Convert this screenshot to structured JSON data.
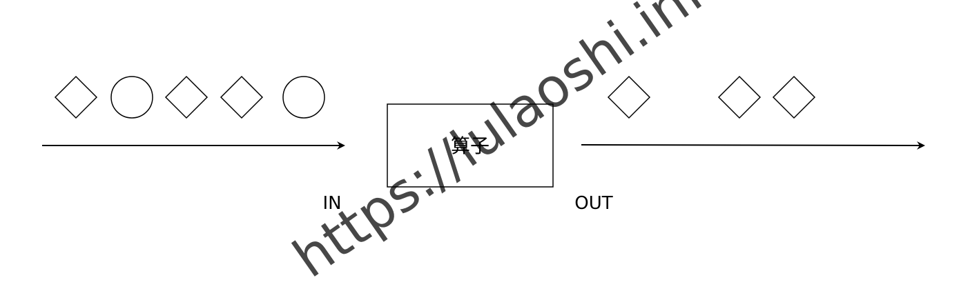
{
  "operator_box": {
    "label": "算子"
  },
  "input_label": "IN",
  "output_label": "OUT",
  "input_stream": [
    "diamond",
    "circle",
    "diamond",
    "diamond",
    "circle"
  ],
  "output_stream": [
    "diamond",
    "diamond",
    "diamond"
  ],
  "watermark": "https://lulaoshi.info/",
  "colors": {
    "stroke": "#000000",
    "background": "#ffffff"
  }
}
